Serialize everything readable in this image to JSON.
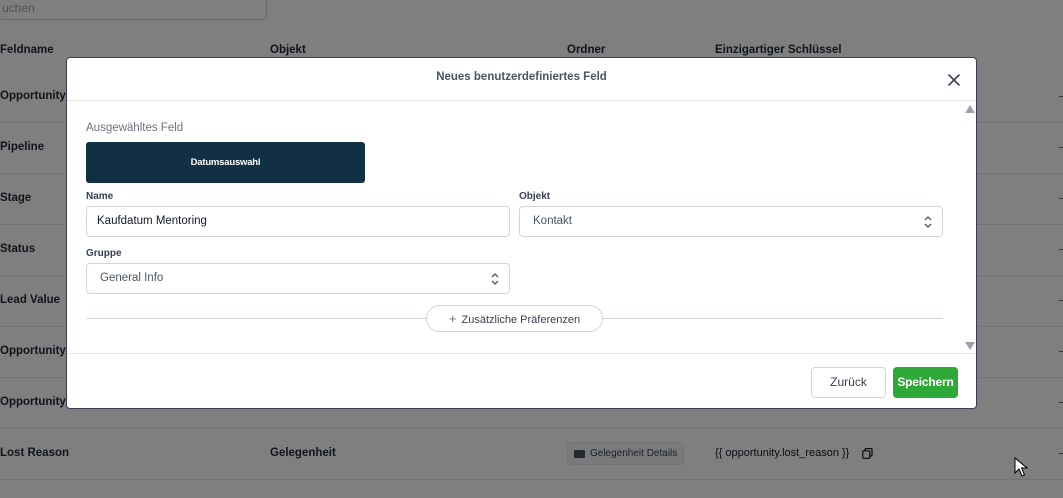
{
  "background": {
    "search_placeholder": "uchen",
    "columns": {
      "field_name": "Feldname",
      "object": "Objekt",
      "folder": "Ordner",
      "unique_key": "Einzigartiger Schlüssel"
    },
    "rows": [
      {
        "field_name": "Opportunity N"
      },
      {
        "field_name": "Pipeline"
      },
      {
        "field_name": "Stage"
      },
      {
        "field_name": "Status"
      },
      {
        "field_name": "Lead Value"
      },
      {
        "field_name": "Opportunity O"
      },
      {
        "field_name": "Opportunity S"
      },
      {
        "field_name": "Lost Reason",
        "object": "Gelegenheit",
        "folder": "Gelegenheit Details",
        "key": "{{ opportunity.lost_reason }}"
      }
    ]
  },
  "modal": {
    "title": "Neues benutzerdefiniertes Feld",
    "selected_field_label": "Ausgewähltes Feld",
    "selected_field_type": "Datumsauswahl",
    "name_label": "Name",
    "name_value": "Kaufdatum Mentoring",
    "object_label": "Objekt",
    "object_value": "Kontakt",
    "group_label": "Gruppe",
    "group_value": "General Info",
    "more_prefs_label": "Zusätzliche Präferenzen",
    "back_label": "Zurück",
    "save_label": "Speichern"
  },
  "colors": {
    "tile_bg": "#123043",
    "save_bg": "#2ea836",
    "overlay": "rgba(0,0,0,0.5)"
  }
}
